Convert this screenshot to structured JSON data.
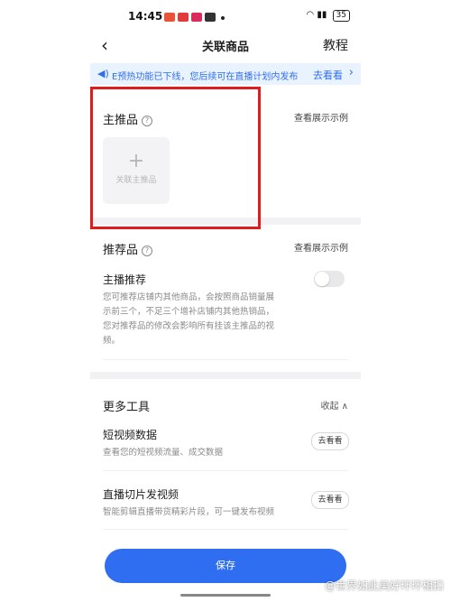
{
  "status_bar": {
    "time": "14:45",
    "battery": "35"
  },
  "nav": {
    "back_icon": "chevron-left-icon",
    "title": "关联商品",
    "tutorial": "教程"
  },
  "notice": {
    "icon": "speaker-icon",
    "text": "E预热功能已下线，您后续可在直播计划内发布",
    "link": "去看看"
  },
  "main_product": {
    "label": "主推品",
    "example_link": "查看展示示例",
    "add_label": "关联主推品"
  },
  "recommended": {
    "label": "推荐品",
    "example_link": "查看展示示例",
    "toggle_title": "主播推荐",
    "toggle_on": false,
    "desc_lines": [
      "您可推荐店铺内其他商品，会按照商品销量展",
      "示前三个，不足三个增补店铺内其他热销品，",
      "您对推荐品的修改会影响所有挂该主推品的视",
      "频。"
    ]
  },
  "more_tools": {
    "label": "更多工具",
    "collapse": "收起",
    "items": [
      {
        "title": "短视频数据",
        "desc": "查看您的短视频流量、成交数据",
        "button": "去看看"
      },
      {
        "title": "直播切片发视频",
        "desc": "智能剪辑直播带货精彩片段，可一键发布视频",
        "button": "去看看"
      }
    ]
  },
  "save_button": "保存",
  "watermark": "@世界如此美好环环相扣"
}
